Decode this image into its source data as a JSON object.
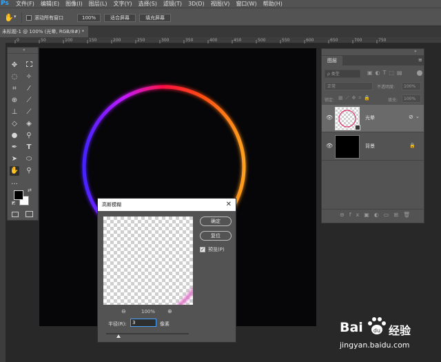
{
  "app": {
    "logo": "Ps"
  },
  "menu": [
    "文件(F)",
    "编辑(E)",
    "图像(I)",
    "图层(L)",
    "文字(Y)",
    "选择(S)",
    "滤镜(T)",
    "3D(D)",
    "视图(V)",
    "窗口(W)",
    "帮助(H)"
  ],
  "options": {
    "scroll_all_label": "滚动所有窗口",
    "zoom_value": "100%",
    "fit_screen_label": "适合屏幕",
    "fill_screen_label": "填充屏幕"
  },
  "document": {
    "tab_title": "未标题-1 @ 100% (光晕, RGB/8#) *"
  },
  "ruler": {
    "marks": [
      "0",
      "50",
      "100",
      "150",
      "200",
      "250",
      "300",
      "350",
      "400",
      "450",
      "500",
      "550",
      "600",
      "650",
      "700",
      "750"
    ]
  },
  "layers": {
    "tab_label": "图层",
    "kind_label": "ρ 类型",
    "blend_mode": "正常",
    "opacity_label": "不透明度:",
    "opacity_value": "100%",
    "lock_label": "锁定:",
    "fill_label": "填充:",
    "fill_value": "100%",
    "items": [
      {
        "name": "光晕"
      },
      {
        "name": "背景"
      }
    ]
  },
  "dialog": {
    "title": "高斯模糊",
    "ok_label": "确定",
    "reset_label": "复位",
    "preview_label": "预览(P)",
    "zoom_value": "100%",
    "radius_label": "半径(R):",
    "radius_value": "3",
    "unit_label": "像素"
  },
  "watermark": {
    "brand": "Bai",
    "brand2": "经验",
    "url": "jingyan.baidu.com"
  },
  "colors": {
    "accent": "#31a8ff",
    "panel": "#535353",
    "canvas": "#060507"
  }
}
